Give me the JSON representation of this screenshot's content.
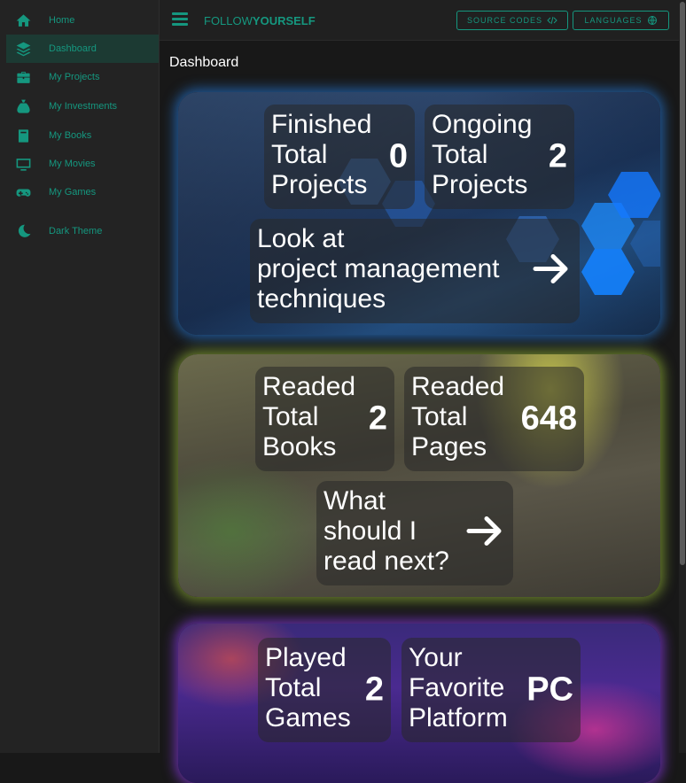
{
  "sidebar": {
    "items": [
      {
        "label": "Home",
        "icon": "home-icon"
      },
      {
        "label": "Dashboard",
        "icon": "layers-icon"
      },
      {
        "label": "My Projects",
        "icon": "briefcase-icon"
      },
      {
        "label": "My Investments",
        "icon": "money-bag-icon"
      },
      {
        "label": "My Books",
        "icon": "book-icon"
      },
      {
        "label": "My Movies",
        "icon": "monitor-icon"
      },
      {
        "label": "My Games",
        "icon": "gamepad-icon"
      }
    ],
    "theme_label": "Dark Theme"
  },
  "header": {
    "brand_light": "FOLLOW",
    "brand_bold": "YOURSELF",
    "source_codes": "SOURCE CODES",
    "languages": "LANGUAGES"
  },
  "page": {
    "title": "Dashboard"
  },
  "projects": {
    "finished_label": "Finished\nTotal\nProjects",
    "finished_value": "0",
    "ongoing_label": "Ongoing\nTotal\nProjects",
    "ongoing_value": "2",
    "link_label": "Look at\nproject management\ntechniques"
  },
  "books": {
    "read_books_label": "Readed\nTotal\nBooks",
    "read_books_value": "2",
    "read_pages_label": "Readed\nTotal\nPages",
    "read_pages_value": "648",
    "link_label": "What\nshould I\nread next?"
  },
  "games": {
    "played_label": "Played\nTotal\nGames",
    "played_value": "2",
    "platform_label": "Your\nFavorite\nPlatform",
    "platform_value": "PC"
  },
  "colors": {
    "accent": "#15977f",
    "background": "#181818",
    "sidebar": "#232323"
  }
}
